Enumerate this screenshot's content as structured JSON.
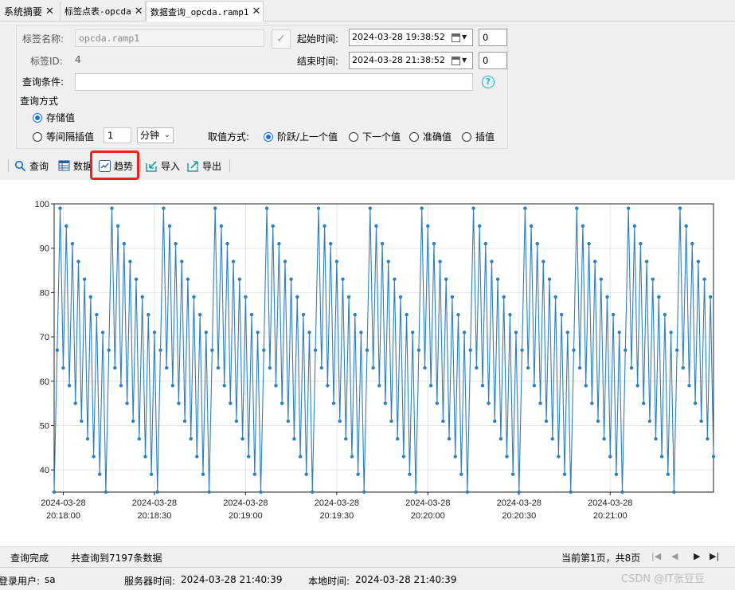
{
  "tabs": [
    {
      "label": "系统摘要"
    },
    {
      "label": "标签点表-opcda"
    },
    {
      "label": "数据查询_opcda.ramp1"
    }
  ],
  "form": {
    "tag_name_label": "标签名称:",
    "tag_name_value": "opcda.ramp1",
    "tag_id_label": "标签ID:",
    "tag_id_value": "4",
    "query_cond_label": "查询条件:",
    "query_cond_value": "",
    "start_time_label": "起始时间:",
    "start_time_value": "2024-03-28 19:38:52",
    "start_ms": "0",
    "end_time_label": "结束时间:",
    "end_time_value": "2024-03-28 21:38:52",
    "end_ms": "0",
    "help_glyph": "?",
    "query_mode_label": "查询方式",
    "mode_stored": "存储值",
    "mode_interval": "等间隔插值",
    "interval_value": "1",
    "interval_unit": "分钟",
    "value_method_label": "取值方式:",
    "method_prev": "阶跃/上一个值",
    "method_next": "下一个值",
    "method_exact": "准确值",
    "method_interp": "插值"
  },
  "toolbar": {
    "query": "查询",
    "data": "数据",
    "trend": "趋势",
    "import": "导入",
    "export": "导出"
  },
  "status": {
    "state": "查询完成",
    "count_text": "共查询到7197条数据",
    "page_text": "当前第1页，共8页"
  },
  "footer": {
    "user_label": "登录用户:",
    "user_value": "sa",
    "server_time_label": "服务器时间:",
    "server_time_value": "2024-03-28 21:40:39",
    "local_time_label": "本地时间:",
    "local_time_value": "2024-03-28 21:40:39",
    "watermark": "CSDN @IT张豆豆"
  },
  "colors": {
    "series": "#2f7fb8",
    "highlight": "#e8231c",
    "accent": "#1a6fd1"
  },
  "chart_data": {
    "type": "line",
    "title": "",
    "xlabel": "",
    "ylabel": "",
    "ylim": [
      35,
      100
    ],
    "yticks": [
      40,
      50,
      60,
      70,
      80,
      90,
      100
    ],
    "xticks": [
      {
        "date": "2024-03-28",
        "time": "20:18:00"
      },
      {
        "date": "2024-03-28",
        "time": "20:18:30"
      },
      {
        "date": "2024-03-28",
        "time": "20:19:00"
      },
      {
        "date": "2024-03-28",
        "time": "20:19:30"
      },
      {
        "date": "2024-03-28",
        "time": "20:20:00"
      },
      {
        "date": "2024-03-28",
        "time": "20:20:30"
      },
      {
        "date": "2024-03-28",
        "time": "20:21:00"
      }
    ],
    "grid": true,
    "x_start": "2024-03-28 20:17:57",
    "sample_interval_s": 1,
    "series": [
      {
        "values": [
          35,
          67,
          99,
          63,
          95,
          59,
          91,
          55,
          87,
          51,
          83,
          47,
          79,
          43,
          75,
          39,
          71,
          35,
          67,
          99,
          63,
          95,
          59,
          91,
          55,
          87,
          51,
          83,
          47,
          79,
          43,
          75,
          39,
          71,
          35,
          67,
          99,
          63,
          95,
          59,
          91,
          55,
          87,
          51,
          83,
          47,
          79,
          43,
          75,
          39,
          71,
          35,
          67,
          99,
          63,
          95,
          59,
          91,
          55,
          87,
          51,
          83,
          47,
          79,
          43,
          75,
          39,
          71,
          35,
          67,
          99,
          63,
          95,
          59,
          91,
          55,
          87,
          51,
          83,
          47,
          79,
          43,
          75,
          39,
          71,
          35,
          67,
          99,
          63,
          95,
          59,
          91,
          55,
          87,
          51,
          83,
          47,
          79,
          43,
          75,
          39,
          71,
          35,
          67,
          99,
          63,
          95,
          59,
          91,
          55,
          87,
          51,
          83,
          47,
          79,
          43,
          75,
          39,
          71,
          35,
          67,
          99,
          63,
          95,
          59,
          91,
          55,
          87,
          51,
          83,
          47,
          79,
          43,
          75,
          39,
          71,
          35,
          67,
          99,
          63,
          95,
          59,
          91,
          55,
          87,
          51,
          83,
          47,
          79,
          43,
          75,
          39,
          71,
          35,
          67,
          99,
          63,
          95,
          59,
          91,
          55,
          87,
          51,
          83,
          47,
          79,
          43,
          75,
          39,
          71,
          35,
          67,
          99,
          63,
          95,
          59,
          91,
          55,
          87,
          51,
          83,
          47,
          79,
          43,
          75,
          39,
          71,
          35,
          67,
          99,
          63,
          95,
          59,
          91,
          55,
          87,
          51,
          83,
          47,
          79,
          43,
          75,
          39,
          71,
          35,
          67,
          99,
          63,
          95,
          59,
          91,
          55,
          87,
          51,
          83,
          47,
          79,
          43
        ]
      }
    ]
  }
}
